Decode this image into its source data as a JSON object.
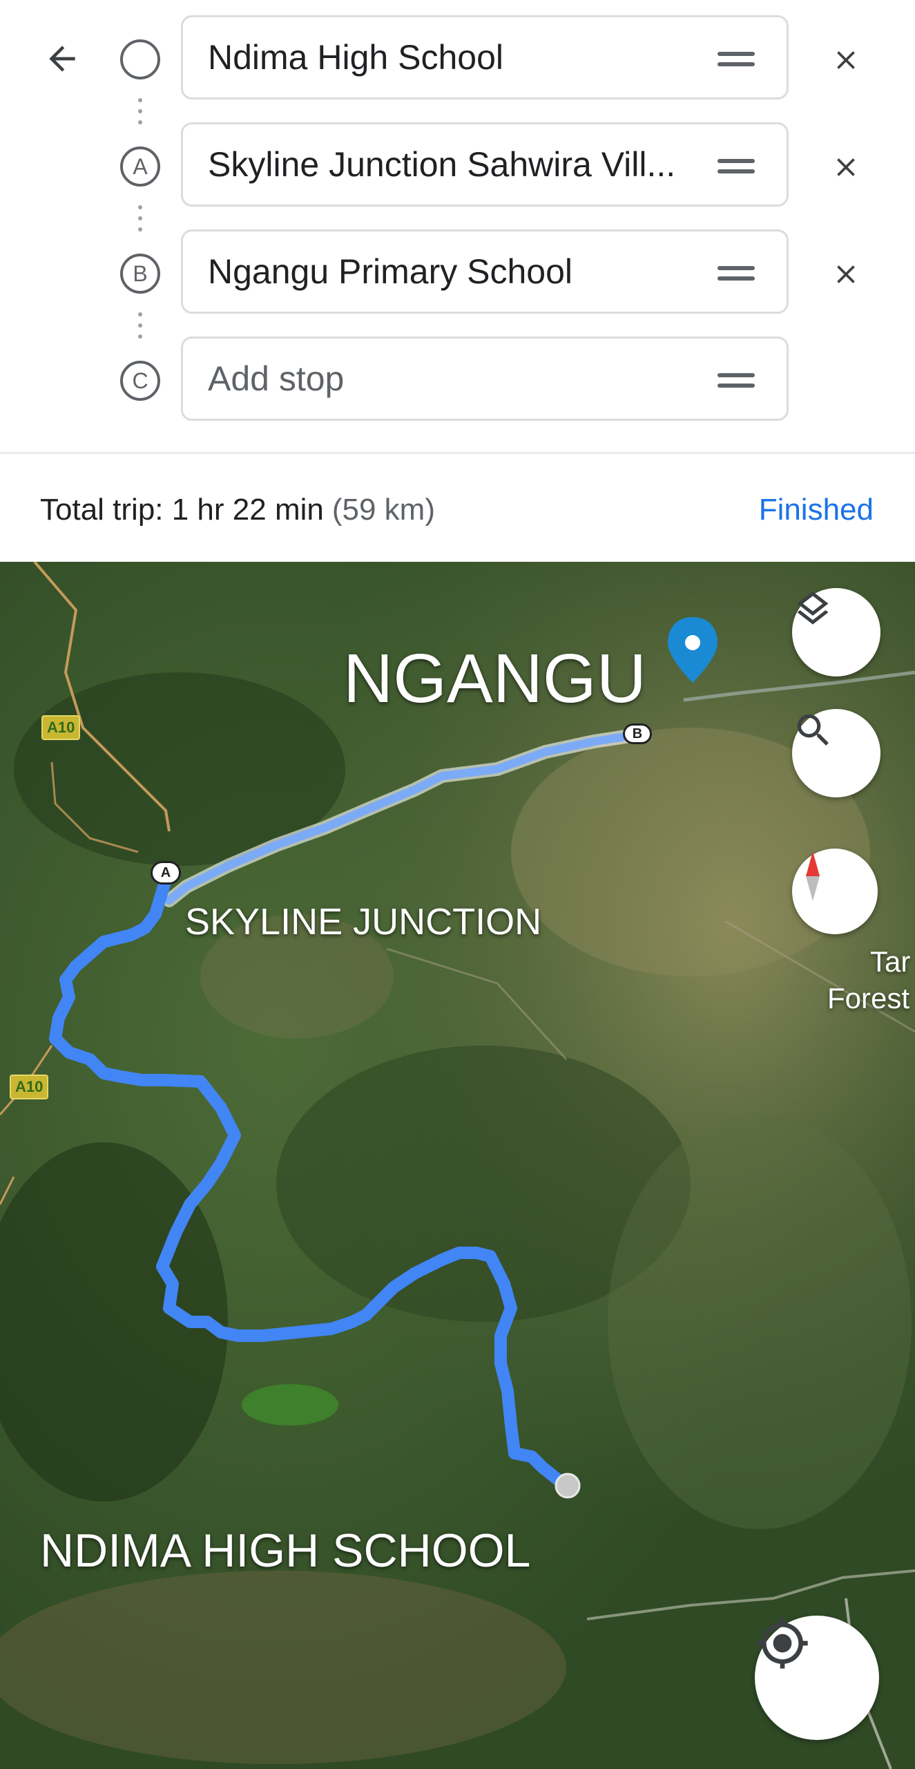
{
  "stops": [
    {
      "marker": "",
      "value": "Ndima High School",
      "placeholder": ""
    },
    {
      "marker": "A",
      "value": "Skyline Junction Sahwira Vill...",
      "placeholder": ""
    },
    {
      "marker": "B",
      "value": "Ngangu Primary School",
      "placeholder": ""
    },
    {
      "marker": "C",
      "value": "",
      "placeholder": "Add stop"
    }
  ],
  "summary": {
    "total_trip": "Total trip: 1 hr 22 min",
    "distance": "(59 km)",
    "finished_label": "Finished"
  },
  "map": {
    "labels": {
      "ngangu": "NGANGU",
      "skyline": "SKYLINE JUNCTION",
      "ndima": "NDIMA HIGH SCHOOL",
      "forest_line1": "Tar",
      "forest_line2": "Forest"
    },
    "road_shield": "A10",
    "route_markers": {
      "a": "A",
      "b": "B"
    },
    "route_color": "#4285f4",
    "route_completed_color": "#7baaf7",
    "pin_color": "#1a8ad4"
  },
  "icons": {
    "back": "arrow-back-icon",
    "layers": "layers-icon",
    "search": "search-icon",
    "compass": "compass-icon",
    "location": "my-location-icon"
  }
}
